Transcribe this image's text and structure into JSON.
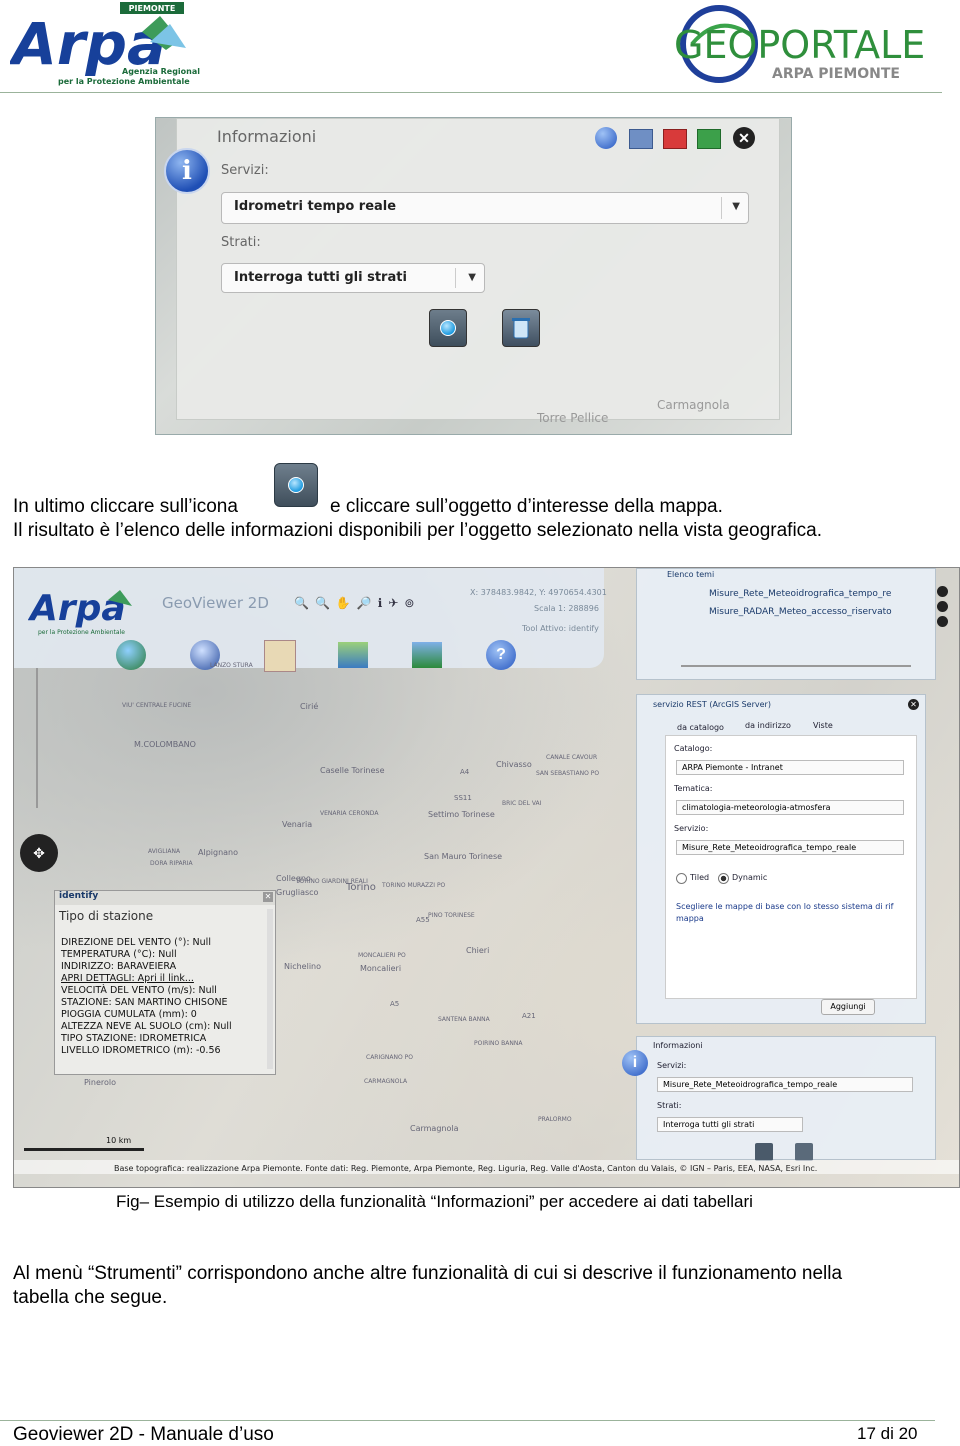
{
  "header": {
    "arpa_logo_text": "Arpa",
    "arpa_badge": "PIEMONTE",
    "arpa_tagline_1": "Agenzia Regionale",
    "arpa_tagline_2": "per la Protezione Ambientale",
    "geo_logo_main": "GEOPORTALE",
    "geo_logo_sub": "ARPA PIEMONTE"
  },
  "shot1": {
    "panel_title": "Informazioni",
    "servizi_label": "Servizi:",
    "servizi_value": "Idrometri tempo reale",
    "strati_label": "Strati:",
    "strati_value": "Interroga tutti gli strati",
    "map_label_1": "Torre Pellice",
    "map_label_2": "Carmagnola"
  },
  "text": {
    "line1_a": "In ultimo cliccare sull’icona",
    "line1_b": "e cliccare sull’oggetto d’interesse della mappa.",
    "line2": "Il risultato è l’elenco delle informazioni disponibili per l’oggetto selezionato nella vista geografica.",
    "caption": "Fig– Esempio di utilizzo della funzionalità “Informazioni” per accedere ai dati tabellari",
    "para2_l1": "Al menù “Strumenti” corrispondono anche altre funzionalità di cui si descrive il funzionamento nella",
    "para2_l2": "tabella che segue."
  },
  "shot2": {
    "app_title": "GeoViewer 2D",
    "coords": "X: 378483.9842, Y: 4970654.4301",
    "scale": "Scala 1: 288896",
    "tool": "Tool Attivo: identify",
    "elenco_temi": "Elenco temi",
    "layer1": "Misure_Rete_Meteoidrografica_tempo_re",
    "layer2": "Misure_RADAR_Meteo_accesso_riservato",
    "rest_title": "servizio REST (ArcGIS Server)",
    "tab1": "da catalogo",
    "tab2": "da indirizzo",
    "tab3": "Viste",
    "catalogo_label": "Catalogo:",
    "catalogo_value": "ARPA Piemonte - Intranet",
    "tematica_label": "Tematica:",
    "tematica_value": "climatologia-meteorologia-atmosfera",
    "servizio_label": "Servizio:",
    "servizio_value": "Misure_Rete_Meteoidrografica_tempo_reale",
    "tiled": "Tiled",
    "dynamic": "Dynamic",
    "scegliere": "Scegliere le mappe di base con lo stesso sistema di rif",
    "mappa": "mappa",
    "aggiungi": "Aggiungi",
    "info_title": "Informazioni",
    "info_servizi": "Servizi:",
    "info_servizi_value": "Misure_Rete_Meteoidrografica_tempo_reale",
    "info_strati": "Strati:",
    "info_strati_value": "Interroga tutti gli strati",
    "identify_title": "identify",
    "identify_sub": "Tipo di stazione",
    "identify_rows": [
      "DIREZIONE DEL VENTO (°): Null",
      "TEMPERATURA (°C): Null",
      "INDIRIZZO: BARAVEIERA",
      "APRI DETTAGLI: Apri il link...",
      "VELOCITÀ DEL VENTO (m/s): Null",
      "STAZIONE: SAN MARTINO CHISONE",
      "PIOGGIA CUMULATA (mm): 0",
      "ALTEZZA NEVE AL SUOLO (cm): Null",
      "TIPO STAZIONE: IDROMETRICA",
      "LIVELLO IDROMETRICO (m): -0.56"
    ],
    "scale_bar": "10 km",
    "credits": "Base topografica: realizzazione Arpa Piemonte. Fonte dati: Reg. Piemonte, Arpa Piemonte, Reg. Liguria, Reg. Valle d'Aosta, Canton du Valais, © IGN – Paris, EEA, NASA, Esri Inc.",
    "places": [
      "Cirié",
      "M.COLOMBANO",
      "Caselle Torinese",
      "Chivasso",
      "Settimo Torinese",
      "Venaria",
      "Alpignano",
      "San Mauro Torinese",
      "Collegno",
      "Grugliasco",
      "Torino",
      "Chieri",
      "Nichelino",
      "Moncalieri",
      "Pinerolo",
      "Carmagnola",
      "VIU' CENTRALE FUCINE",
      "LANZO STURA",
      "CANALE CAVOUR",
      "SAN SEBASTIANO PO",
      "VENARIA CERONDA",
      "TORINO GIARDINI REALI",
      "TORINO MURAZZI PO",
      "PINO TORINESE",
      "MONCALIERI PO",
      "SANTENA BANNA",
      "POIRINO BANNA",
      "CARIGNANO PO",
      "CARMAGNOLA",
      "PRALORMO",
      "AVIGLIANA",
      "DORA RIPARIA",
      "BRIC DEL VAI",
      "A4",
      "A5",
      "A21",
      "A55",
      "SS11"
    ]
  },
  "footer": {
    "left": "Geoviewer 2D -  Manuale d’uso",
    "right": "17 di 20"
  }
}
